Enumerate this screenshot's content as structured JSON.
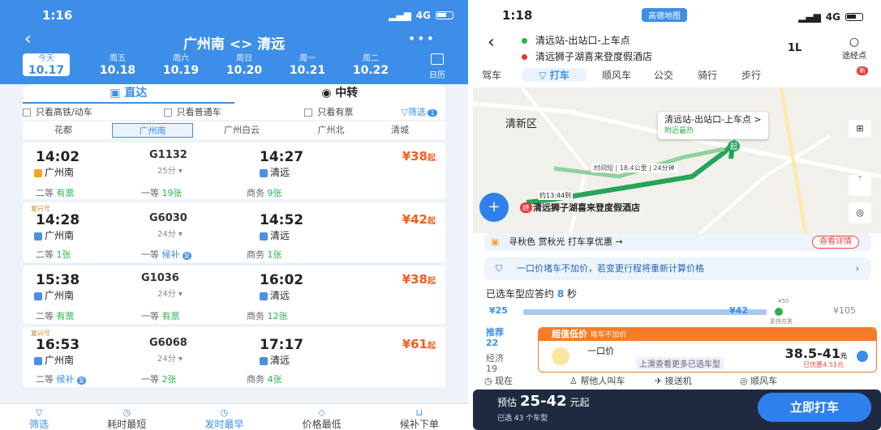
{
  "left": {
    "status_time": "1:16",
    "signal": "4G",
    "title": "广州南 <> 清远",
    "dates": [
      {
        "w": "今天",
        "d": "10.17"
      },
      {
        "w": "周五",
        "d": "10.18"
      },
      {
        "w": "周六",
        "d": "10.19"
      },
      {
        "w": "周日",
        "d": "10.20"
      },
      {
        "w": "周一",
        "d": "10.21"
      },
      {
        "w": "周二",
        "d": "10.22"
      }
    ],
    "calendar": "日历",
    "tab_direct": "直达",
    "tab_transfer": "中转",
    "filter1": "只看高铁/动车",
    "filter2": "只看普通车",
    "filter3": "只看有票",
    "filter_btn": "筛选",
    "filter_count": "1",
    "stations": [
      "花都",
      "广州南",
      "广州白云",
      "广州北",
      "清城"
    ],
    "trains": [
      {
        "tag": "",
        "dep": "14:02",
        "no": "G1132",
        "dur": "25分",
        "arr": "14:27",
        "from": "广州南",
        "to": "清远",
        "price": "38",
        "s1": "二等",
        "v1": "有票",
        "s2": "一等",
        "v2": "19张",
        "s3": "商务",
        "v3": "9张"
      },
      {
        "tag": "复兴号",
        "dep": "14:28",
        "no": "G6030",
        "dur": "24分",
        "arr": "14:52",
        "from": "广州南",
        "to": "清远",
        "price": "42",
        "s1": "二等",
        "v1": "1张",
        "s2": "一等",
        "v2": "候补",
        "s3": "商务",
        "v3": "1张"
      },
      {
        "tag": "",
        "dep": "15:38",
        "no": "G1036",
        "dur": "24分",
        "arr": "16:02",
        "from": "广州南",
        "to": "清远",
        "price": "38",
        "s1": "二等",
        "v1": "有票",
        "s2": "一等",
        "v2": "有票",
        "s3": "商务",
        "v3": "12张"
      },
      {
        "tag": "复兴号",
        "dep": "16:53",
        "no": "G6068",
        "dur": "24分",
        "arr": "17:17",
        "from": "广州南",
        "to": "清远",
        "price": "61",
        "s1": "二等",
        "v1": "候补",
        "s2": "一等",
        "v2": "2张",
        "s3": "商务",
        "v3": "4张"
      }
    ],
    "bottom": [
      "筛选",
      "耗时最短",
      "发时最早",
      "价格最低",
      "候补下单"
    ],
    "price_unit": "起",
    "fu": "复"
  },
  "right": {
    "status_time": "1:18",
    "app_badge": "高德地图",
    "signal": "4G",
    "start": "清远站-出站口-上车点",
    "end": "清远狮子湖喜来登度假酒店",
    "swap": "1L",
    "via": "途经点",
    "modes": [
      "驾车",
      "打车",
      "顺风车",
      "公交",
      "骑行",
      "步行"
    ],
    "new_badge": "新",
    "map_district": "清新区",
    "callout_title": "清远站-出站口-上车点 >",
    "callout_sub": "附近最热",
    "route_info": "时间短 | 18.4公里 | 24分钟",
    "time_label": "约13:44到",
    "start_marker": "起",
    "end_marker": "终",
    "dest_name": "清远狮子湖喜来登度假酒店",
    "promo": "寻秋色 赏秋光 打车享优惠 →",
    "promo_btn": "查看详情",
    "fixed": "一口价堵车不加价，若变更行程将重新计算价格",
    "wait_prefix": "已选车型应答约",
    "wait_value": "8",
    "wait_suffix": "秒",
    "p_low": "¥25",
    "p_mid": "¥42",
    "p_high": "¥105",
    "p_50": "¥50",
    "p_fast": "更快应答",
    "offer_title": "超值低价",
    "offer_sub": "堵车不加价",
    "offer_opt": "一口价",
    "offer_price": "38.5-41",
    "offer_unit": "元",
    "coupon": "已优惠4.51元",
    "hint": "上滑查看更多已选车型",
    "cat1": "推荐",
    "cat1n": "22",
    "cat2": "经济",
    "cat2n": "19",
    "subnav": [
      "现在",
      "帮他人叫车",
      "接送机",
      "顺风车"
    ],
    "est_label": "预估",
    "est_price": "25-42",
    "est_unit": "元起",
    "est_sub": "已选 43 个车型",
    "call_btn": "立即打车"
  }
}
